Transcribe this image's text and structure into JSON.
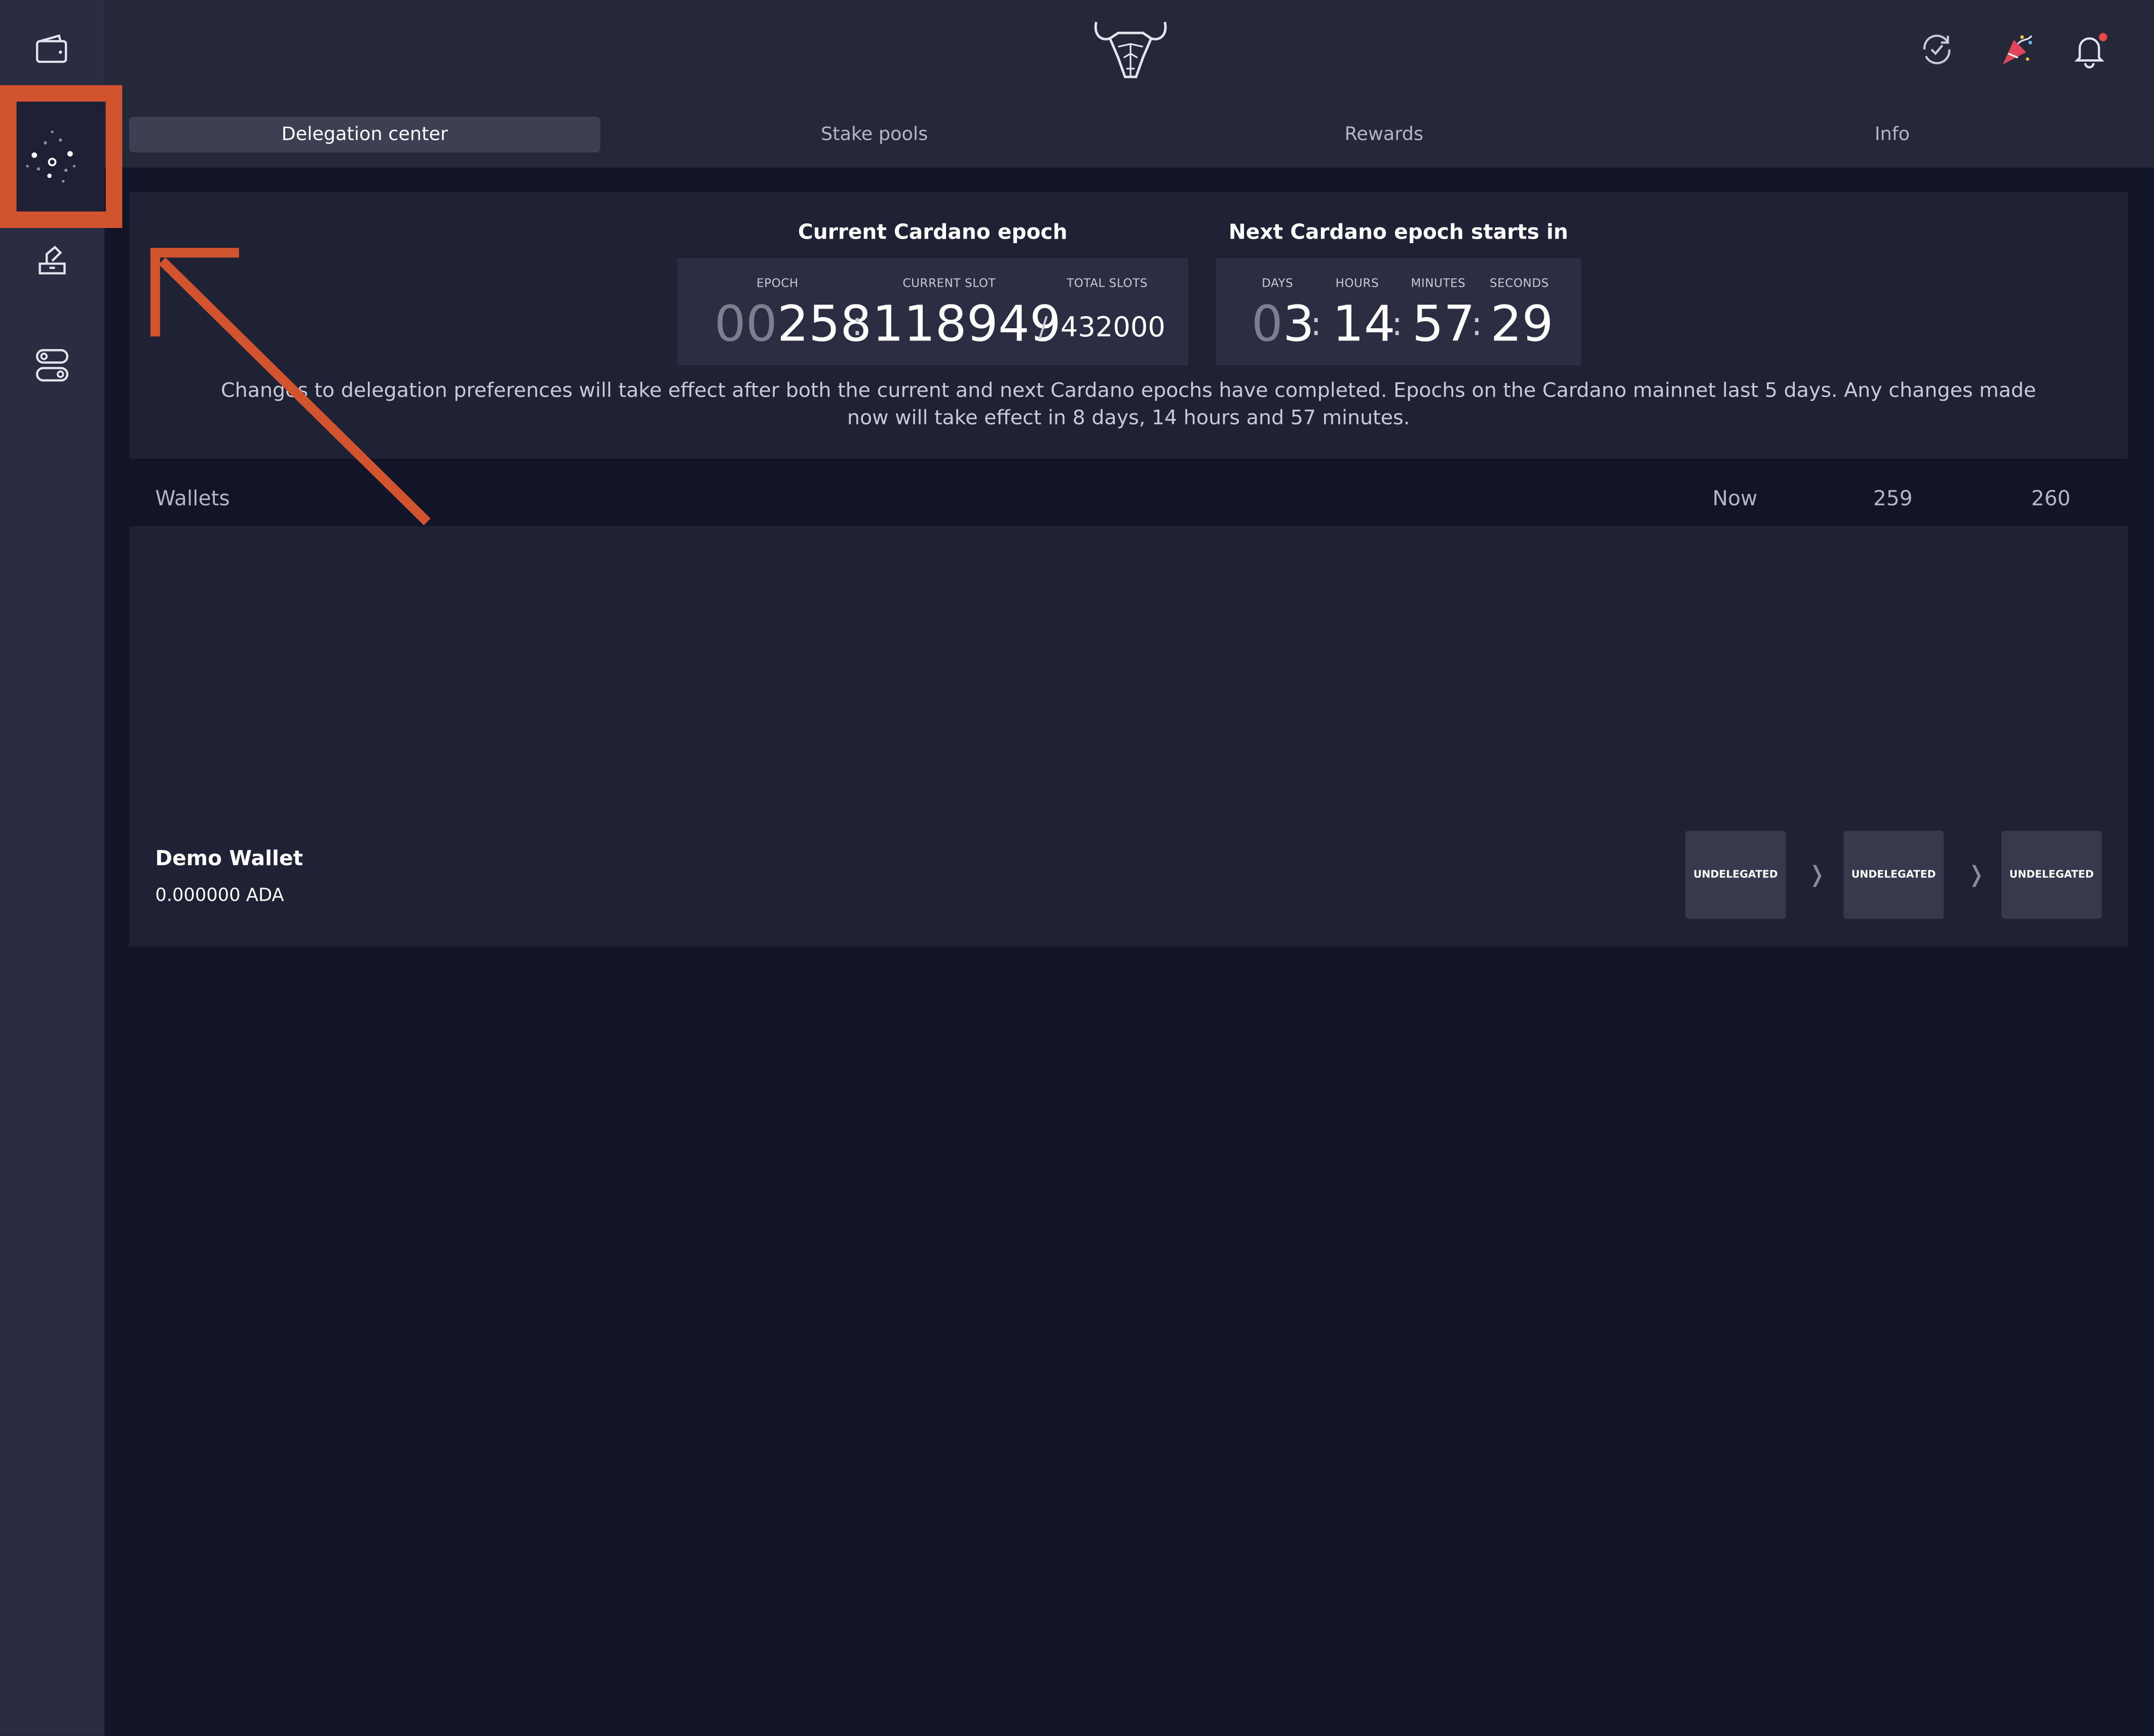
{
  "sidebar": {
    "items": [
      {
        "icon": "wallet-icon"
      },
      {
        "icon": "delegation-network-icon",
        "active": true
      },
      {
        "icon": "voting-icon"
      },
      {
        "icon": "settings-toggle-icon"
      }
    ]
  },
  "header": {
    "logo": "daedalus-bull-logo",
    "icons": [
      "sync-status-icon",
      "newsfeed-party-icon",
      "notification-bell-icon"
    ]
  },
  "tabs": [
    {
      "label": "Delegation center",
      "active": true
    },
    {
      "label": "Stake pools"
    },
    {
      "label": "Rewards"
    },
    {
      "label": "Info"
    }
  ],
  "epoch": {
    "current_title": "Current Cardano epoch",
    "next_title": "Next Cardano epoch starts in",
    "labels": {
      "epoch": "EPOCH",
      "current_slot": "CURRENT SLOT",
      "total_slots": "TOTAL SLOTS",
      "days": "DAYS",
      "hours": "HOURS",
      "minutes": "MINUTES",
      "seconds": "SECONDS"
    },
    "epoch_prefix": "00",
    "epoch_value": "258",
    "current_slot": "118949",
    "total_slots": "432000",
    "days_prefix": "0",
    "days": "3",
    "hours": "14",
    "minutes": "57",
    "seconds": "29",
    "notice": "Changes to delegation preferences will take effect after both the current and next Cardano epochs have completed. Epochs on the Cardano mainnet last 5 days. Any changes made now will take effect in 8 days, 14 hours and 57 minutes."
  },
  "wallets_header": {
    "label": "Wallets",
    "columns": [
      "Now",
      "259",
      "260"
    ]
  },
  "wallets": [
    {
      "name": "Demo Wallet",
      "amount": "0.000000 ADA",
      "statuses": [
        "UNDELEGATED",
        "UNDELEGATED",
        "UNDELEGATED"
      ]
    }
  ],
  "colors": {
    "annotation": "#d2542e",
    "background": "#121528",
    "sidebar": "#2a2d42",
    "panel": "#1f2235"
  }
}
